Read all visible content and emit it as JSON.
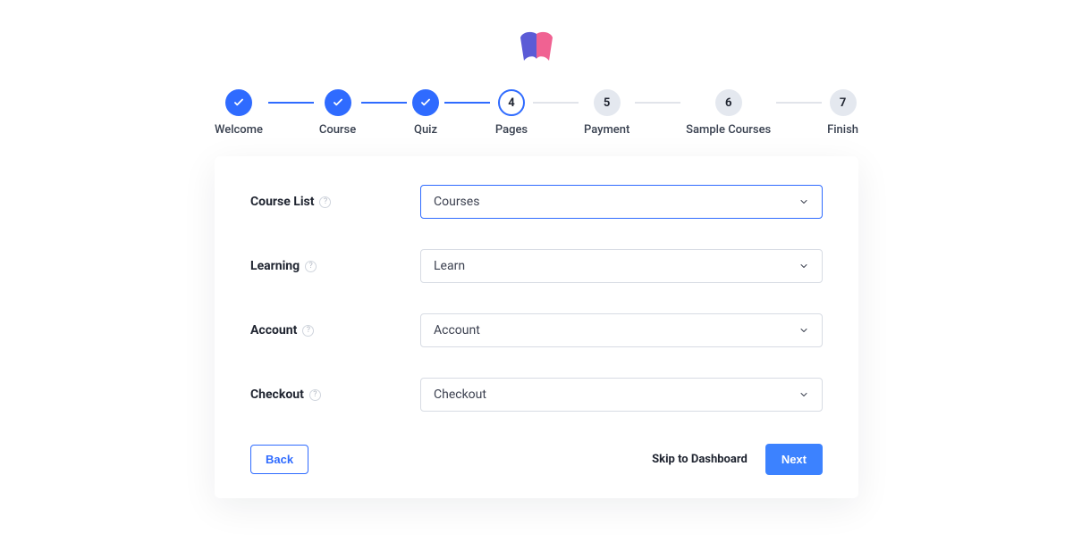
{
  "stepper": {
    "steps": [
      {
        "label": "Welcome",
        "state": "completed"
      },
      {
        "label": "Course",
        "state": "completed"
      },
      {
        "label": "Quiz",
        "state": "completed"
      },
      {
        "label": "Pages",
        "number": "4",
        "state": "active"
      },
      {
        "label": "Payment",
        "number": "5",
        "state": "upcoming"
      },
      {
        "label": "Sample Courses",
        "number": "6",
        "state": "upcoming"
      },
      {
        "label": "Finish",
        "number": "7",
        "state": "upcoming"
      }
    ]
  },
  "form": {
    "rows": [
      {
        "label": "Course List",
        "value": "Courses",
        "focused": true
      },
      {
        "label": "Learning",
        "value": "Learn",
        "focused": false
      },
      {
        "label": "Account",
        "value": "Account",
        "focused": false
      },
      {
        "label": "Checkout",
        "value": "Checkout",
        "focused": false
      }
    ]
  },
  "footer": {
    "back": "Back",
    "skip": "Skip to Dashboard",
    "next": "Next"
  }
}
